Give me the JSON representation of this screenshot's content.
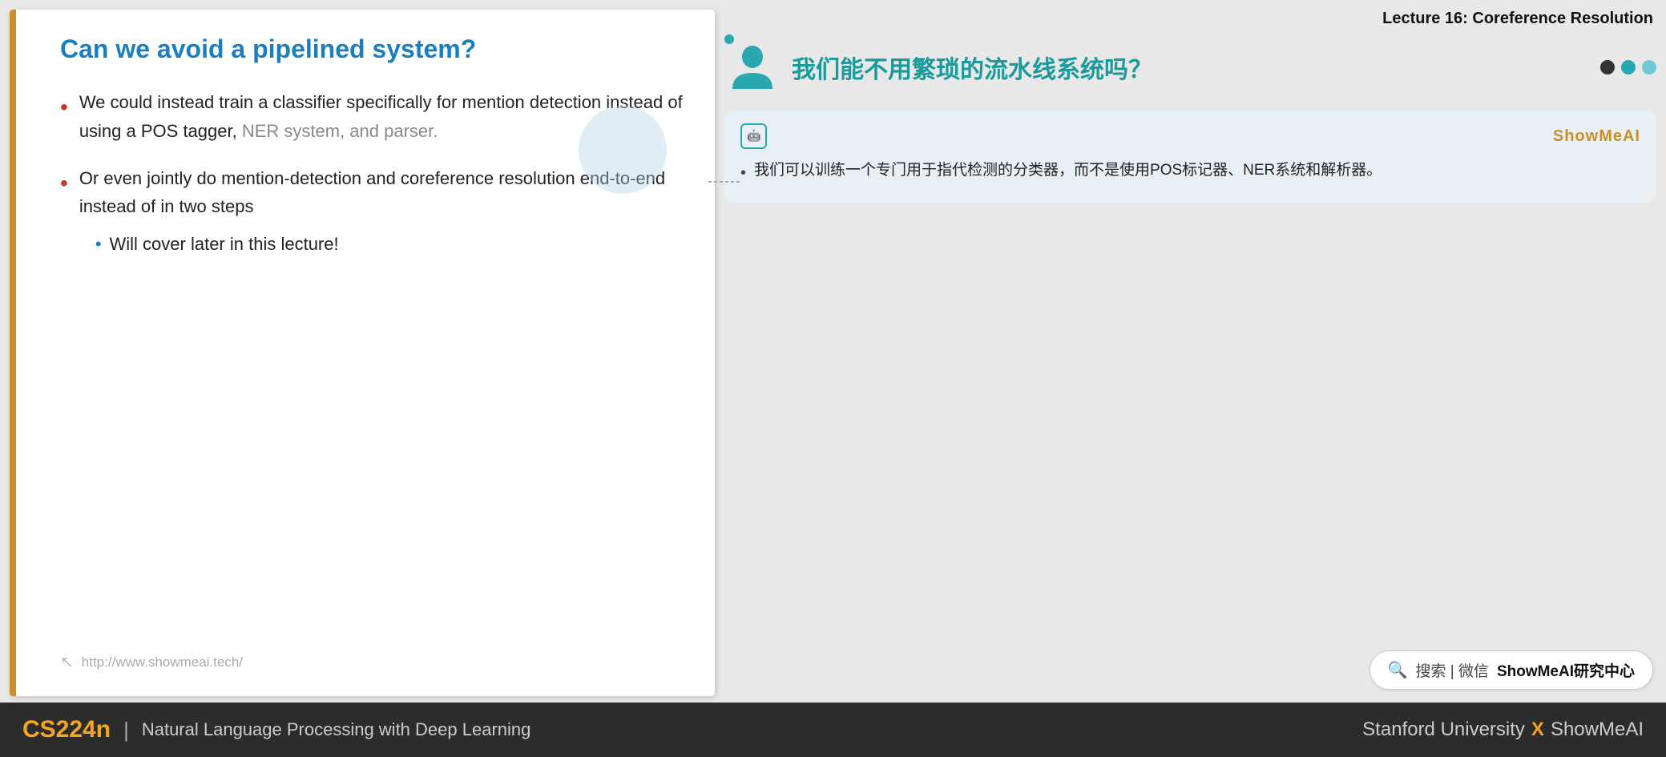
{
  "lecture": {
    "title": "Lecture 16: Coreference Resolution"
  },
  "slide": {
    "title": "Can we avoid a pipelined system?",
    "border_color": "#c8902a",
    "bullets": [
      {
        "text_before": "We could instead train a classifier specifically for mention detection instead of using a POS tagger, ",
        "text_grey": "NER system, and parser.",
        "text_after": ""
      },
      {
        "text": "Or even jointly do mention-detection and coreference resolution end-to-end instead of in two steps",
        "sub_bullets": [
          {
            "text": "Will cover later in this lecture!"
          }
        ]
      }
    ],
    "footer_link": "http://www.showmeai.tech/"
  },
  "translation_panel": {
    "title": "我们能不用繁琐的流水线系统吗？",
    "ai_icon_label": "AI",
    "showmeai_label": "ShowMeAI",
    "bullet_lines": [
      "我们可以训练一个专门用于指代检测的分类器，而不是使用POS标记器、NER系统和解析器。"
    ],
    "dots": [
      {
        "color": "#333"
      },
      {
        "color": "#2aa8b0"
      },
      {
        "color": "#6ec8d8"
      }
    ]
  },
  "search_bar": {
    "icon_label": "🔍",
    "text": "搜索 | 微信",
    "bold_text": "ShowMeAI研究中心"
  },
  "bottom_bar": {
    "course_code": "CS224n",
    "divider": "|",
    "course_title": "Natural Language Processing with Deep Learning",
    "right_text_1": "Stanford University",
    "right_x": "X",
    "right_text_2": "ShowMeAI"
  }
}
